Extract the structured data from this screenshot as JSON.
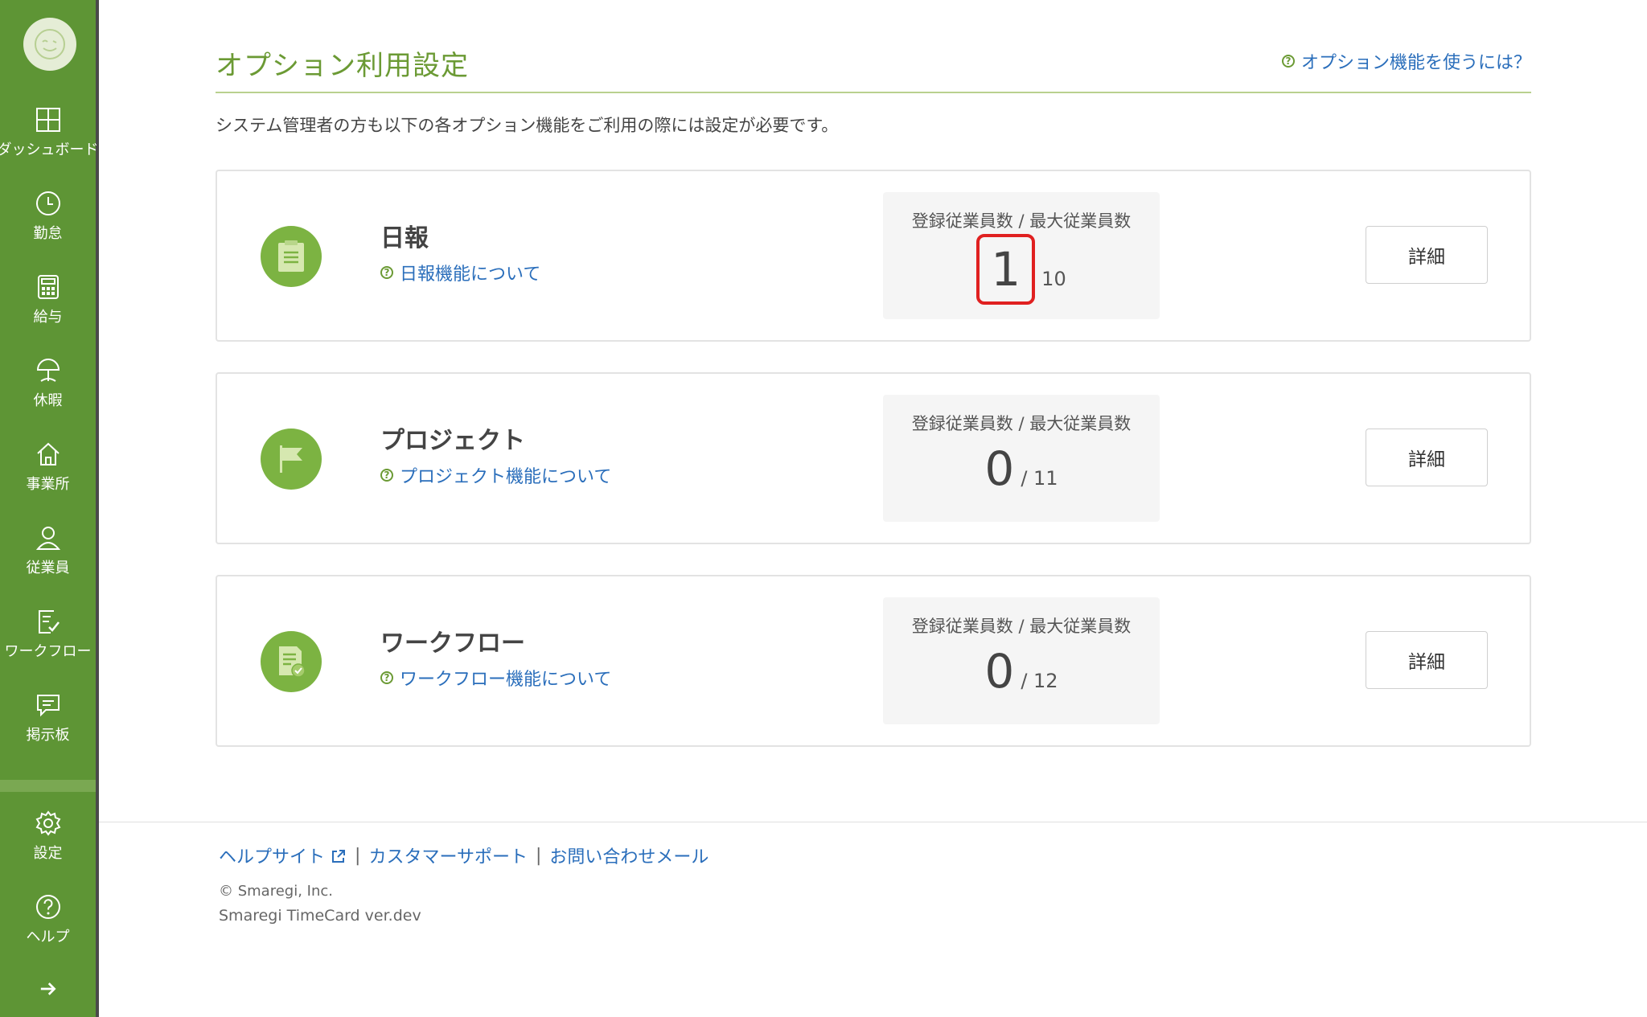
{
  "sidebar": {
    "items": [
      {
        "label": "ダッシュボード",
        "icon": "dashboard-icon"
      },
      {
        "label": "勤怠",
        "icon": "clock-icon"
      },
      {
        "label": "給与",
        "icon": "calculator-icon"
      },
      {
        "label": "休暇",
        "icon": "parasol-icon"
      },
      {
        "label": "事業所",
        "icon": "home-icon"
      },
      {
        "label": "従業員",
        "icon": "person-icon"
      },
      {
        "label": "ワークフロー",
        "icon": "checklist-icon"
      },
      {
        "label": "掲示板",
        "icon": "message-icon"
      }
    ],
    "bottom_items": [
      {
        "label": "設定",
        "icon": "gear-icon"
      },
      {
        "label": "ヘルプ",
        "icon": "help-icon"
      }
    ],
    "expand_icon": "arrow-right-icon",
    "accent_color": "#5e9535"
  },
  "header": {
    "title": "オプション利用設定",
    "help_link": "オプション機能を使うには？"
  },
  "intro_text": "システム管理者の方も以下の各オプション機能をご利用の際には設定が必要です。",
  "options": [
    {
      "name": "日報",
      "about_link": "日報機能について",
      "stat_label": "登録従業員数 / 最大従業員数",
      "count": "1",
      "max": "10",
      "detail_label": "詳細",
      "icon": "clipboard-icon"
    },
    {
      "name": "プロジェクト",
      "about_link": "プロジェクト機能について",
      "stat_label": "登録従業員数 / 最大従業員数",
      "count": "0",
      "max": "/ 11",
      "detail_label": "詳細",
      "icon": "flag-icon"
    },
    {
      "name": "ワークフロー",
      "about_link": "ワークフロー機能について",
      "stat_label": "登録従業員数 / 最大従業員数",
      "count": "0",
      "max": "/ 12",
      "detail_label": "詳細",
      "icon": "document-check-icon"
    }
  ],
  "footer": {
    "help_site": "ヘルプサイト",
    "customer_support": "カスタマーサポート",
    "contact_mail": "お問い合わせメール",
    "separator": "|",
    "copyright": "© Smaregi, Inc.",
    "version": "Smaregi TimeCard ver.dev"
  },
  "colors": {
    "title_green": "#6b9a34",
    "link_blue": "#2a6ebb",
    "highlight_red": "#e02020",
    "icon_green": "#7cb342"
  }
}
